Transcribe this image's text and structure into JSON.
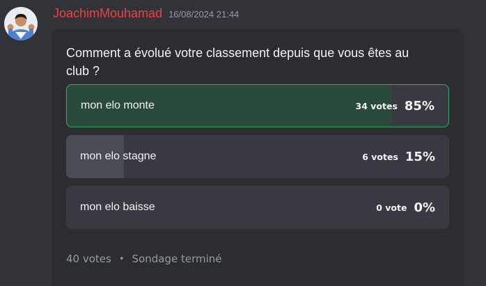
{
  "message": {
    "author": "JoachimMouhamad",
    "timestamp": "16/08/2024 21:44",
    "author_color": "#f23f43"
  },
  "poll": {
    "question": "Comment a évolué votre classement depuis que vous êtes au club ?",
    "answers": [
      {
        "label": "mon elo monte",
        "votes": "34 votes",
        "percent": "85%",
        "fraction": 0.85,
        "winner": true
      },
      {
        "label": "mon elo stagne",
        "votes": "6 votes",
        "percent": "15%",
        "fraction": 0.15,
        "winner": false
      },
      {
        "label": "mon elo baisse",
        "votes": "0 vote",
        "percent": "0%",
        "fraction": 0.0,
        "winner": false
      }
    ],
    "total_votes": "40 votes",
    "separator": "•",
    "status": "Sondage terminé"
  },
  "colors": {
    "winner_border": "#3fa969",
    "winner_fill": "#2a4b3a",
    "fill": "#4a4c54"
  }
}
